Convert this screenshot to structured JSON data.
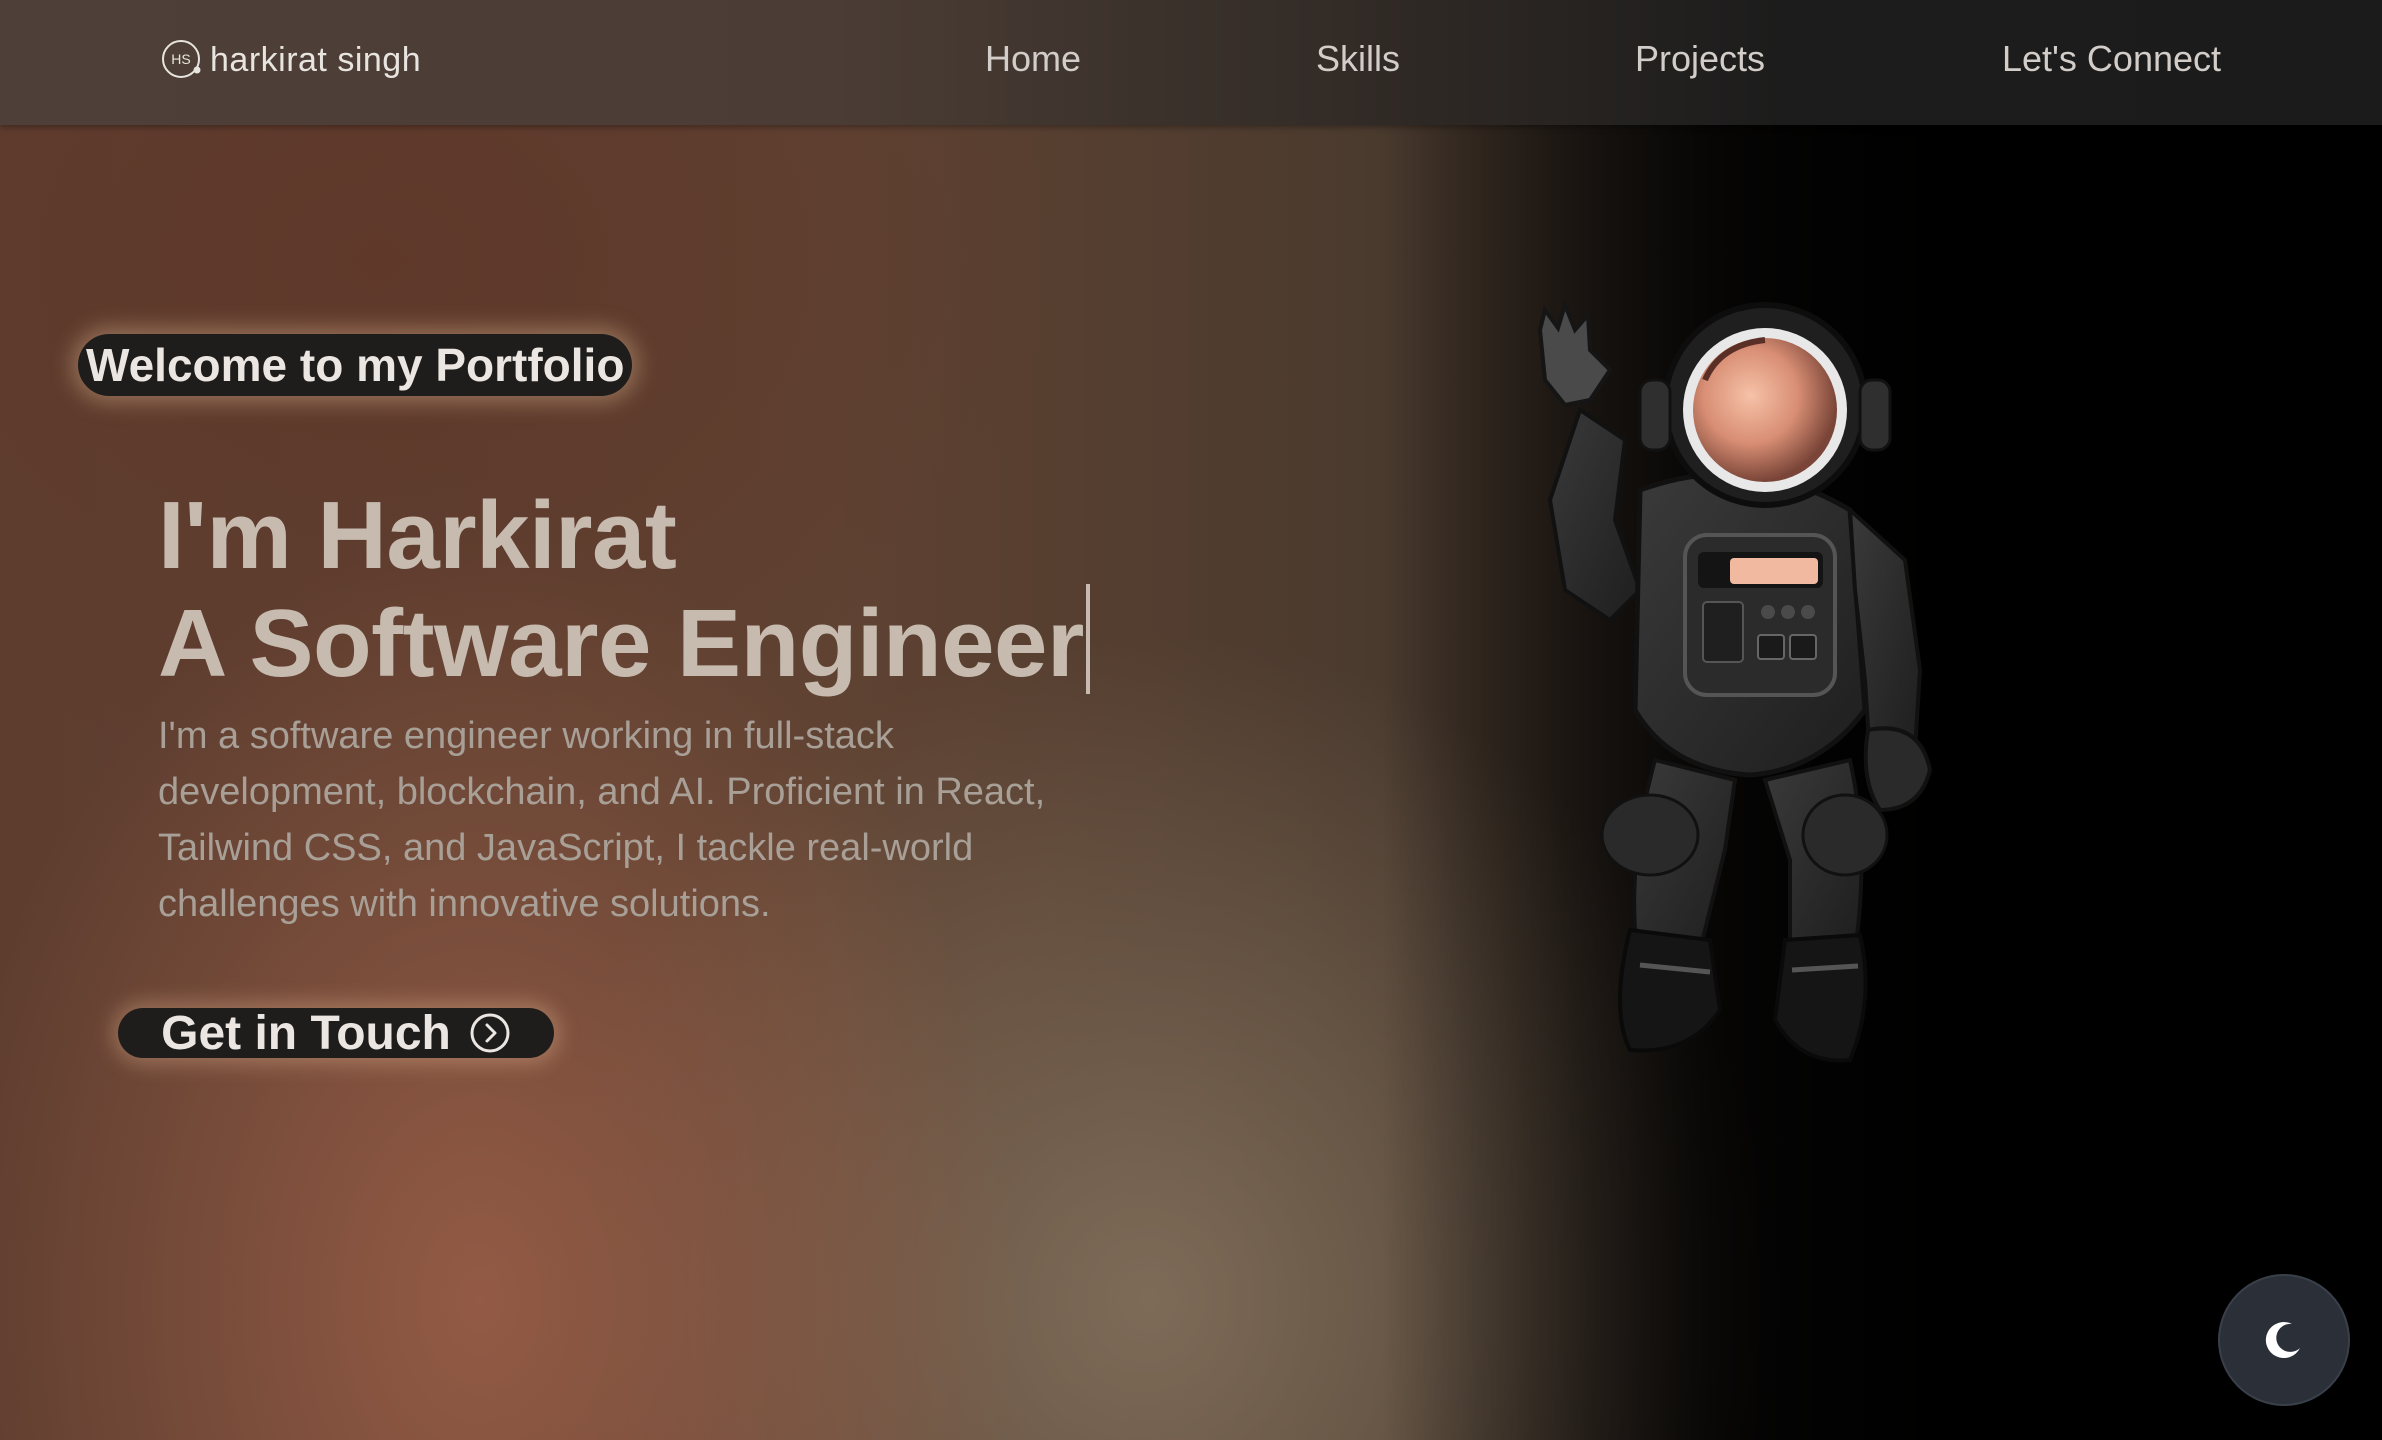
{
  "nav": {
    "logo_text": "harkirat singh",
    "logo_monogram": "HS",
    "links": [
      {
        "label": "Home"
      },
      {
        "label": "Skills"
      },
      {
        "label": "Projects"
      },
      {
        "label": "Let's Connect"
      }
    ]
  },
  "hero": {
    "badge": "Welcome to my Portfolio",
    "heading_line1": "I'm Harkirat",
    "heading_line2": "A Software Engineer",
    "description": "I'm a software engineer working in full-stack development, blockchain, and AI. Proficient in React, Tailwind CSS, and JavaScript, I tackle real-world challenges with innovative solutions.",
    "cta_label": "Get in Touch",
    "cta_icon": "chevron-right-circle-icon"
  },
  "illustration": {
    "name": "astronaut-illustration"
  },
  "theme_toggle": {
    "icon": "moon-icon"
  },
  "colors": {
    "heading": "#c7bbb0",
    "description": "#a89f97",
    "pill_bg": "#1e1d1c",
    "toggle_bg": "#2a2f38"
  }
}
